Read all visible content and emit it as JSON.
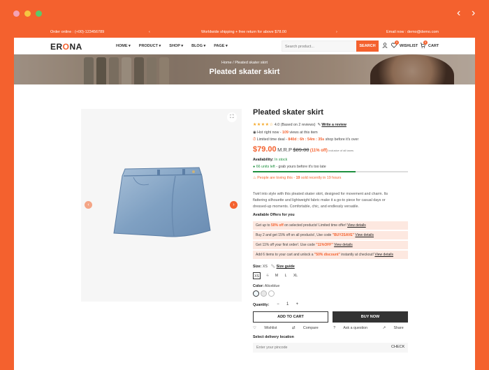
{
  "topbar": {
    "order": "Order online : (+00)-123456789",
    "promo": "Worldwide shipping + free return for above $78.00",
    "email": "Email now : demo@demo.com"
  },
  "header": {
    "logo_prefix": "ER",
    "logo_accent": "O",
    "logo_suffix": "NA",
    "menu": [
      "HOME",
      "PRODUCT",
      "SHOP",
      "BLOG",
      "PAGE"
    ],
    "search_placeholder": "Search product...",
    "search_button": "SEARCH",
    "wishlist_label": "WISHLIST",
    "wishlist_count": "0",
    "cart_label": "CART",
    "cart_count": "0"
  },
  "hero": {
    "breadcrumb": "Home / Pleated skater skirt",
    "title": "Pleated skater skirt"
  },
  "product": {
    "title": "Pleated skater skirt",
    "stars": "★★★★☆",
    "rating": "4.0 (Based on 2 reviews)",
    "write_review": "Write a review",
    "hot_prefix": "Hot right now -",
    "hot_views": "109",
    "hot_suffix": "views at this item",
    "deal_prefix": "Limited time deal -",
    "deal_timer": "840d : 6h : 54m : 35s",
    "deal_suffix": "shop before it's over",
    "price": "$79.00",
    "mrp_label": "M.R.P",
    "mrp": "$89.00",
    "off": "(11% off)",
    "tax": "inclusive of all taxes",
    "availability_label": "Availability:",
    "availability": "In stock",
    "units_prefix": "66 units left",
    "units_suffix": "- grab yours before it's too late",
    "stock_fraction": 0.66,
    "loving_prefix": "People are loving this -",
    "loving_count": "19",
    "loving_suffix": "sold recently in 19 hours",
    "description": "Twirl into style with this pleated skater skirt, designed for movement and charm. Its flattering silhouette and lightweight fabric make it a go-to piece for casual days or dressed-up moments. Comfortable, chic, and endlessly versatile.",
    "offers_title": "Available Offers for you",
    "offers": [
      {
        "pre": "Get up to",
        "hl": "50% off",
        "post": "on selected products! Limited time offer!",
        "link": "View details"
      },
      {
        "pre": "Buy 2 and get 15% off on all products!, Use code",
        "hl": "\"BUY2SAVE\"",
        "post": "",
        "link": "View details"
      },
      {
        "pre": "Get 11% off your first order!. Use code",
        "hl": "\"11%OFF\"",
        "post": "",
        "link": "View details"
      },
      {
        "pre": "Add 6 items to your cart and unlock a",
        "hl": "\"50% discount\"",
        "post": "instantly at checkout!",
        "link": "View details"
      }
    ],
    "size_label": "Size:",
    "size_value": "XS",
    "size_guide": "Size guide",
    "sizes": [
      "XS",
      "S",
      "M",
      "L",
      "XL"
    ],
    "color_label": "Color:",
    "color_value": "Aliceblue",
    "colors": [
      "#f0f8ff",
      "#e8e8e8",
      "#ffffff"
    ],
    "quantity_label": "Quantity:",
    "qty_minus": "−",
    "qty_value": "1",
    "qty_plus": "+",
    "add_to_cart": "ADD TO CART",
    "buy_now": "BUY NOW",
    "wishlist": "Wishlist",
    "compare": "Compare",
    "ask": "Ask a question",
    "share": "Share",
    "delivery_label": "Select delivery location",
    "pincode_placeholder": "Enter your pincode",
    "check": "CHECK"
  },
  "colors": {
    "accent": "#f4612e",
    "dark": "#333333",
    "green": "#1e8f3e"
  }
}
